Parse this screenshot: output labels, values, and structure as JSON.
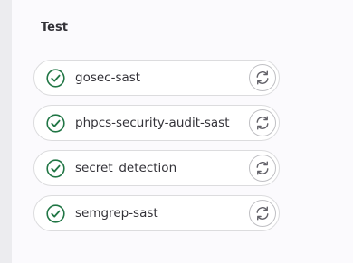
{
  "stage": {
    "title": "Test",
    "jobs": [
      {
        "name": "gosec-sast",
        "status_icon": "status-success-icon",
        "action_icon": "retry-icon"
      },
      {
        "name": "phpcs-security-audit-sast",
        "status_icon": "status-success-icon",
        "action_icon": "retry-icon"
      },
      {
        "name": "secret_detection",
        "status_icon": "status-success-icon",
        "action_icon": "retry-icon"
      },
      {
        "name": "semgrep-sast",
        "status_icon": "status-success-icon",
        "action_icon": "retry-icon"
      }
    ]
  },
  "colors": {
    "success": "#217645",
    "text": "#333238",
    "border": "#dcdcde",
    "icon": "#626168"
  }
}
